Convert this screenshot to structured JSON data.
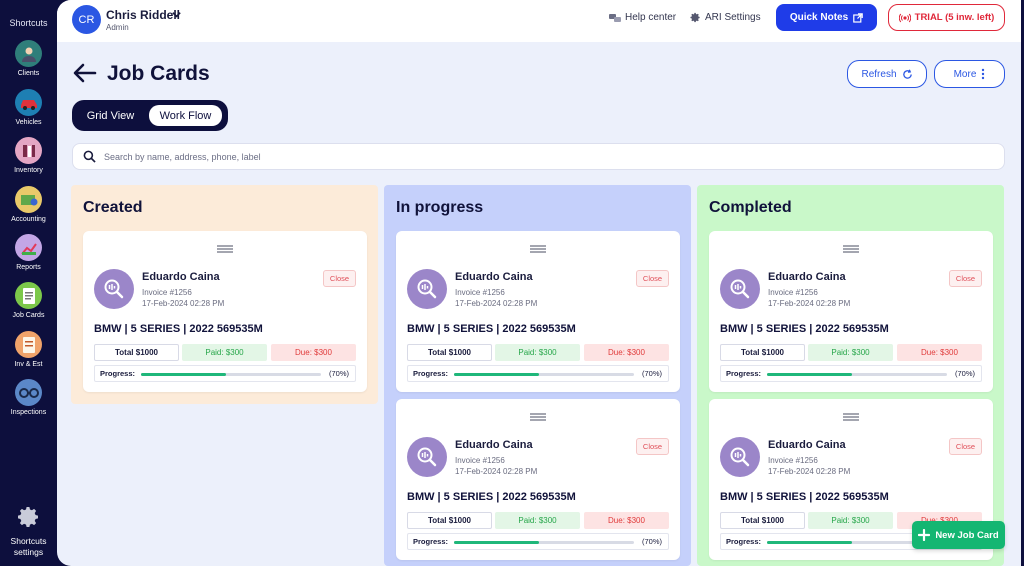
{
  "sidebar": {
    "title": "Shortcuts",
    "items": [
      {
        "label": "Clients",
        "icon": "clients-icon"
      },
      {
        "label": "Vehicles",
        "icon": "vehicles-icon"
      },
      {
        "label": "Inventory",
        "icon": "inventory-icon"
      },
      {
        "label": "Accounting",
        "icon": "accounting-icon"
      },
      {
        "label": "Reports",
        "icon": "reports-icon"
      },
      {
        "label": "Job Cards",
        "icon": "job-cards-icon"
      },
      {
        "label": "Inv & Est",
        "icon": "invoice-estimate-icon"
      },
      {
        "label": "Inspections",
        "icon": "inspections-icon"
      }
    ],
    "settings_line1": "Shortcuts",
    "settings_line2": "settings"
  },
  "header": {
    "avatar_initials": "CR",
    "user_name": "Chris Riddell",
    "user_role": "Admin",
    "help_center": "Help center",
    "ari_settings": "ARI Settings",
    "quick_notes": "Quick Notes",
    "trial": "TRIAL (5 inw. left)"
  },
  "page": {
    "title": "Job Cards",
    "refresh": "Refresh",
    "more": "More",
    "view_grid": "Grid View",
    "view_flow": "Work Flow",
    "search_placeholder": "Search by name, address, phone, label",
    "new_job_card": "New Job Card"
  },
  "columns": [
    {
      "title": "Created"
    },
    {
      "title": "In progress"
    },
    {
      "title": "Completed"
    }
  ],
  "card": {
    "customer": "Eduardo Caina",
    "invoice": "Invoice #1256",
    "date": "17-Feb-2024 02:28 PM",
    "close": "Close",
    "vehicle": "BMW | 5 SERIES | 2022 569535M",
    "total": "Total $1000",
    "paid": "Paid: $300",
    "due": "Due: $300",
    "progress_label": "Progress:",
    "progress_pct": "(70%)",
    "progress_value": 0.47
  },
  "colors": {
    "sidebar_bg": "#0d0f3d",
    "primary": "#1f3ce8",
    "trial_red": "#e0283a",
    "created_bg": "#fcebd9",
    "progress_bg": "#c5d0fb",
    "completed_bg": "#c9f8c9",
    "success": "#14b672"
  }
}
